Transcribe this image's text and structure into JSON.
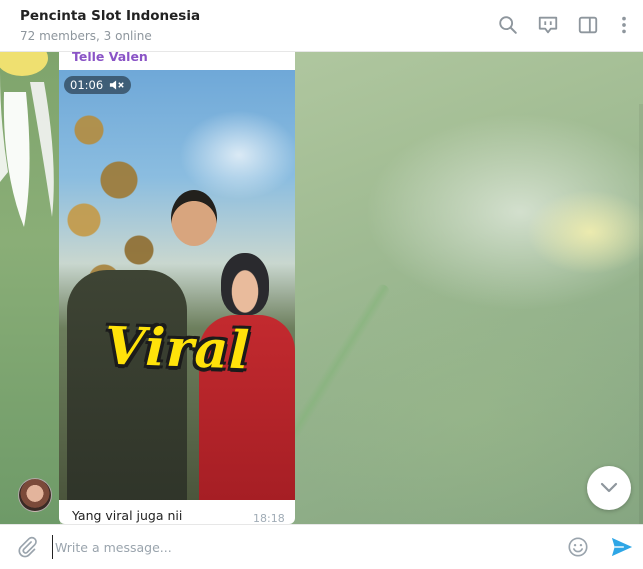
{
  "header": {
    "title": "Pencinta Slot Indonesia",
    "subtitle": "72 members, 3 online",
    "icons": [
      "search-icon",
      "video-chat-icon",
      "sidebar-toggle-icon",
      "more-vertical-icon"
    ]
  },
  "message": {
    "sender": "Telle Valen",
    "video_duration": "01:06",
    "video_overlay_text": "Viral",
    "caption": "Yang viral juga nii",
    "time": "18:18"
  },
  "composer": {
    "placeholder": "Write a message..."
  },
  "colors": {
    "sender_name": "#8a54c6",
    "send_icon": "#2ea6e6",
    "icon_gray": "#8e969d"
  }
}
